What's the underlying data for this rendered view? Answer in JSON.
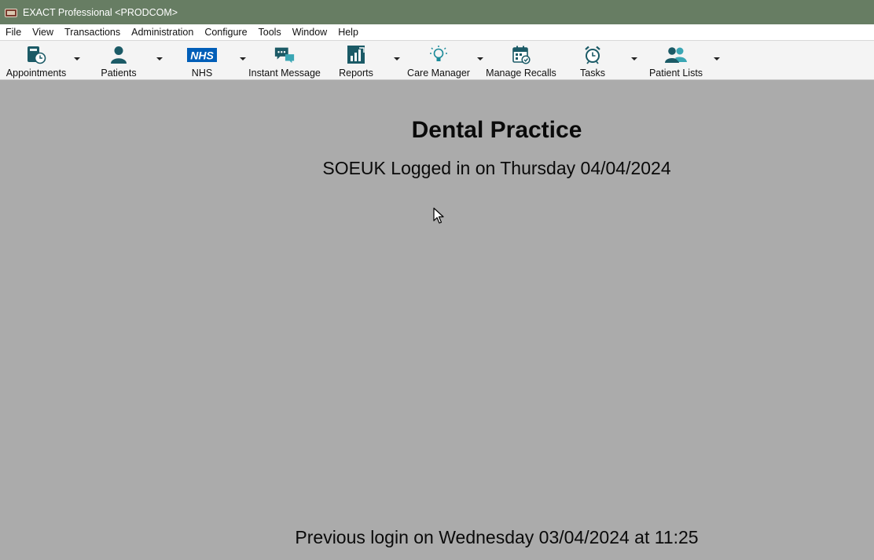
{
  "window": {
    "title": "EXACT Professional <PRODCOM>"
  },
  "menu": [
    "File",
    "View",
    "Transactions",
    "Administration",
    "Configure",
    "Tools",
    "Window",
    "Help"
  ],
  "toolbar": {
    "appointments": "Appointments",
    "patients": "Patients",
    "nhs": "NHS",
    "nhs_logo": "NHS",
    "instant_message": "Instant Message",
    "reports": "Reports",
    "care_manager": "Care Manager",
    "manage_recalls": "Manage Recalls",
    "tasks": "Tasks",
    "patient_lists": "Patient Lists"
  },
  "colors": {
    "icon_teal": "#1b5a66",
    "titlebar": "#677d63",
    "workspace": "#ababab",
    "nhs_blue": "#005eb8"
  },
  "main": {
    "practice_name": "Dental Practice",
    "login_status": "SOEUK Logged in on Thursday 04/04/2024",
    "previous_login": "Previous login on Wednesday 03/04/2024 at 11:25"
  }
}
